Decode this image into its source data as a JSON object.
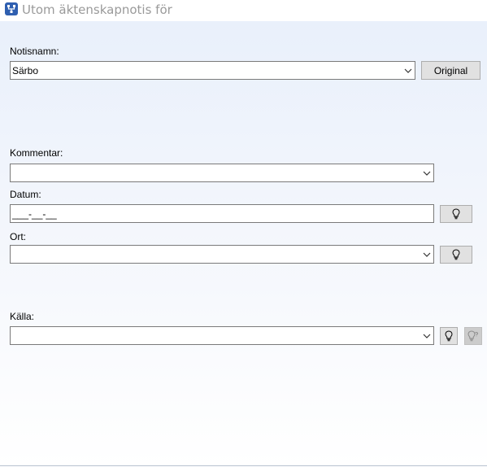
{
  "window": {
    "title": "Utom äktenskapnotis för"
  },
  "notisnamn": {
    "label": "Notisnamn:",
    "value": "Särbo",
    "original_button": "Original"
  },
  "kommentar": {
    "label": "Kommentar:",
    "value": ""
  },
  "datum": {
    "label": "Datum:",
    "value": "___-__-__"
  },
  "ort": {
    "label": "Ort:",
    "value": ""
  },
  "kalla": {
    "label": "Källa:",
    "value": ""
  },
  "icons": {
    "app": "family-tree-app-icon",
    "dropdown": "chevron-down-icon",
    "hint": "lightbulb-icon",
    "hint_disabled": "lightbulb-question-icon"
  },
  "colors": {
    "title_text": "#9a9a9a",
    "content_bg_top": "#e9f0fb",
    "app_icon": "#2f5fb0"
  }
}
